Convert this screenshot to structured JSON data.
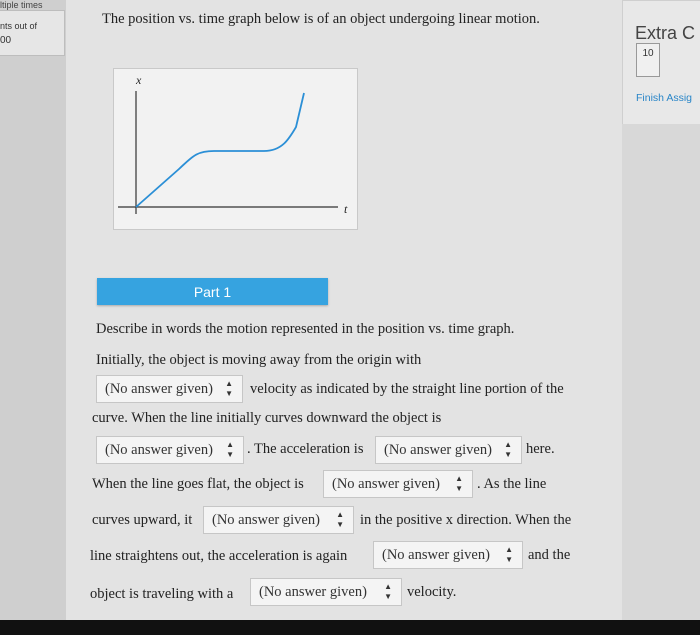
{
  "left": {
    "top_text": "ltiple times",
    "points_label": "nts out of",
    "points_value": "00"
  },
  "question": {
    "prompt": "The position vs. time graph below is of an object undergoing linear motion.",
    "graph": {
      "x_axis_label": "x",
      "t_axis_label": "t"
    }
  },
  "part": {
    "label": "Part 1"
  },
  "body": {
    "intro": "Describe in words the motion represented in the position vs. time graph.",
    "l1": "Initially, the object is moving away from the origin with",
    "l2_after": "velocity as indicated by the straight line portion of the",
    "l3": "curve. When the line initially curves downward the object is",
    "l4_mid": ". The acceleration is",
    "l4_after": "here.",
    "l5_before": "When the line goes flat, the object is",
    "l5_after": ". As the line",
    "l6_before": "curves upward, it",
    "l6_after": "in the positive x direction. When the",
    "l7_before": "line straightens out, the acceleration is again",
    "l7_after": "and the",
    "l8_before": "object is traveling with a",
    "l8_after": "velocity."
  },
  "dropdowns": {
    "d1": "(No answer given)",
    "d2": "(No answer given)",
    "d3": "(No answer given)",
    "d4": "(No answer given)",
    "d5": "(No answer given)",
    "d6": "(No answer given)",
    "d7": "(No answer given)"
  },
  "right": {
    "title": "Extra C",
    "badge": "10",
    "link": "Finish Assig"
  },
  "colors": {
    "accent": "#36a3e0",
    "link": "#2a86c8",
    "graph_line": "#2b8fd6"
  }
}
